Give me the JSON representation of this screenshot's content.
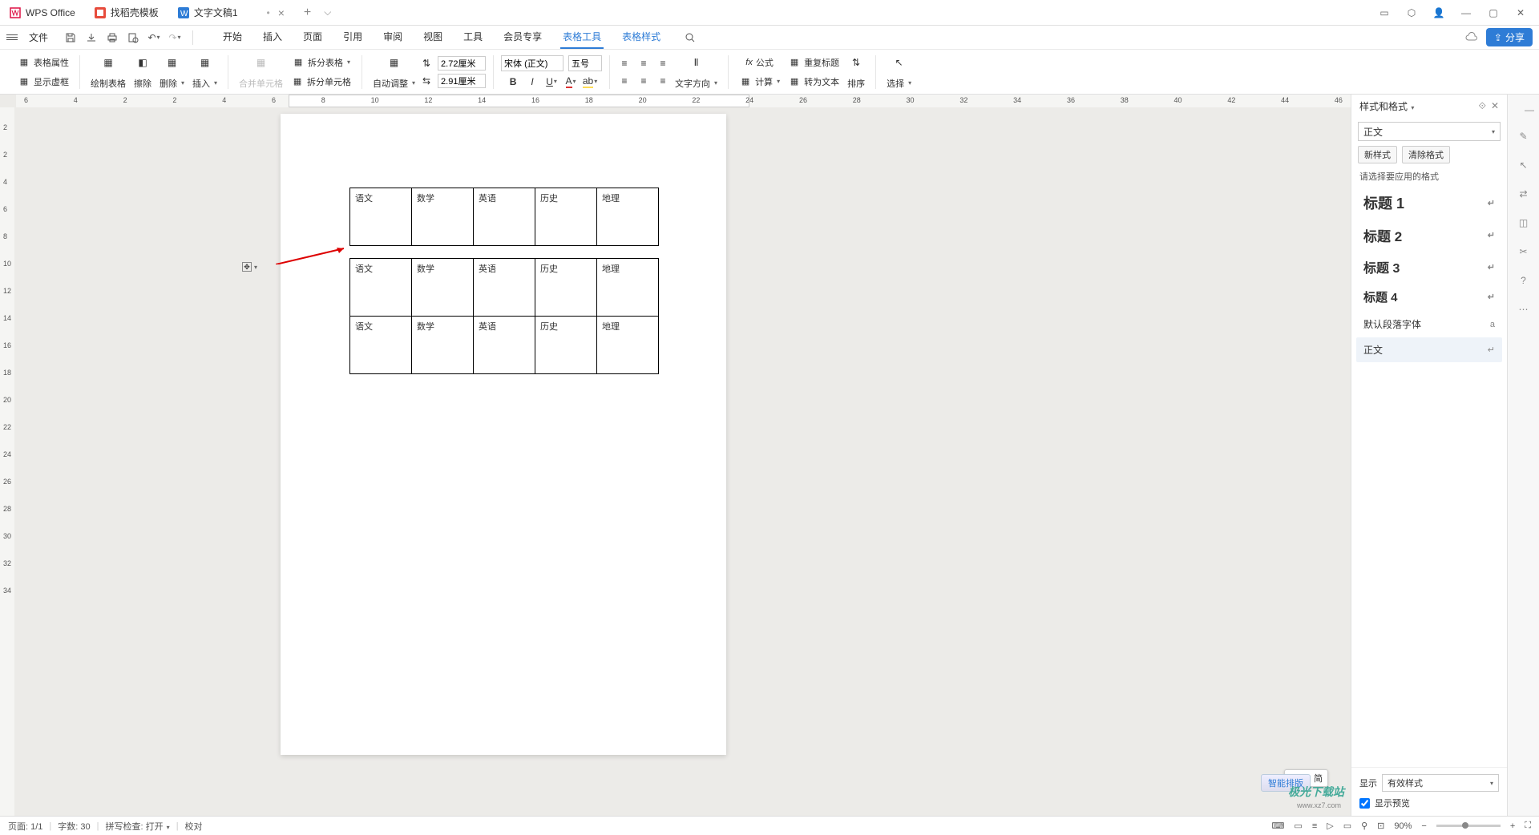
{
  "titlebar": {
    "app": "WPS Office",
    "shell_tab": "找稻壳模板",
    "doc_tab": "文字文稿1"
  },
  "menu": {
    "file": "文件",
    "tabs": [
      "开始",
      "插入",
      "页面",
      "引用",
      "审阅",
      "视图",
      "工具",
      "会员专享",
      "表格工具",
      "表格样式"
    ],
    "active_index": 8,
    "share": "分享"
  },
  "ribbon": {
    "table_props": "表格属性",
    "show_grid": "显示虚框",
    "draw_table": "绘制表格",
    "eraser": "擦除",
    "delete": "删除",
    "insert": "插入",
    "merge_cells": "合并单元格",
    "split_table": "拆分表格",
    "split_cells": "拆分单元格",
    "auto_fit": "自动调整",
    "height_val": "2.72厘米",
    "width_val": "2.91厘米",
    "font_name": "宋体 (正文)",
    "font_size": "五号",
    "text_direction": "文字方向",
    "formula": "公式",
    "calc": "计算",
    "repeat_header": "重复标题",
    "convert_text": "转为文本",
    "sort": "排序",
    "select": "选择"
  },
  "ruler_h_labels": [
    "6",
    "4",
    "2",
    "2",
    "4",
    "6",
    "8",
    "10",
    "12",
    "14",
    "16",
    "18",
    "20",
    "22",
    "24",
    "26",
    "28",
    "30",
    "32",
    "34",
    "36",
    "38",
    "40",
    "42",
    "44",
    "46"
  ],
  "ruler_v_labels": [
    "2",
    "2",
    "4",
    "6",
    "8",
    "10",
    "12",
    "14",
    "16",
    "18",
    "20",
    "22",
    "24",
    "26",
    "28",
    "30",
    "32",
    "34"
  ],
  "table_headers": [
    "语文",
    "数学",
    "英语",
    "历史",
    "地理"
  ],
  "styles": {
    "panel_title": "样式和格式",
    "current": "正文",
    "new_btn": "新样式",
    "clear_btn": "清除格式",
    "prompt": "请选择要应用的格式",
    "items": [
      {
        "label": "标题 1",
        "cls": "h1"
      },
      {
        "label": "标题 2",
        "cls": "h2"
      },
      {
        "label": "标题 3",
        "cls": "h3"
      },
      {
        "label": "标题 4",
        "cls": "h4"
      },
      {
        "label": "默认段落字体",
        "cls": "default"
      },
      {
        "label": "正文",
        "cls": "body"
      }
    ],
    "show_label": "显示",
    "show_value": "有效样式",
    "preview_label": "显示预览"
  },
  "status": {
    "page": "页面: 1/1",
    "words": "字数: 30",
    "spell": "拼写检查: 打开",
    "proof": "校对",
    "zoom": "90%"
  },
  "ime": "CH ♫ 简",
  "smart_layout": "智能排版",
  "watermark": "极光下载站",
  "watermark_url": "www.xz7.com"
}
